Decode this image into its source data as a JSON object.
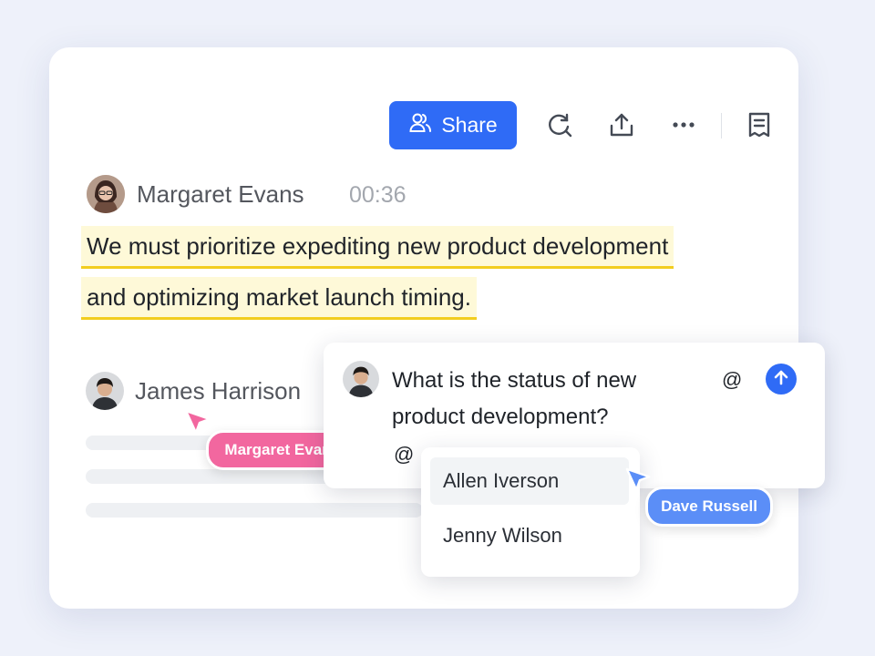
{
  "toolbar": {
    "share_label": "Share",
    "icons": [
      "people-icon",
      "search-refresh-icon",
      "upload-icon",
      "more-icon",
      "notes-icon"
    ]
  },
  "message": {
    "author": "Margaret Evans",
    "timestamp": "00:36",
    "line1": "We must prioritize expediting new product  development",
    "line2": "and optimizing market launch timing."
  },
  "second_speaker": {
    "name": "James Harrison"
  },
  "comment": {
    "text_line1": "What is the status of new",
    "text_line2": "product development?",
    "mention_symbol": "@",
    "input_at": "@"
  },
  "mention_list": {
    "items": [
      "Allen Iverson",
      "Jenny Wilson"
    ]
  },
  "cursors": {
    "pink": {
      "label": "Margaret Evan",
      "color": "#f2679f"
    },
    "blue": {
      "label": "Dave Russell",
      "color": "#5b8ef7"
    }
  },
  "colors": {
    "accent": "#2f6bf6",
    "highlight": "#fef9d8",
    "underline": "#f2cd1f"
  }
}
